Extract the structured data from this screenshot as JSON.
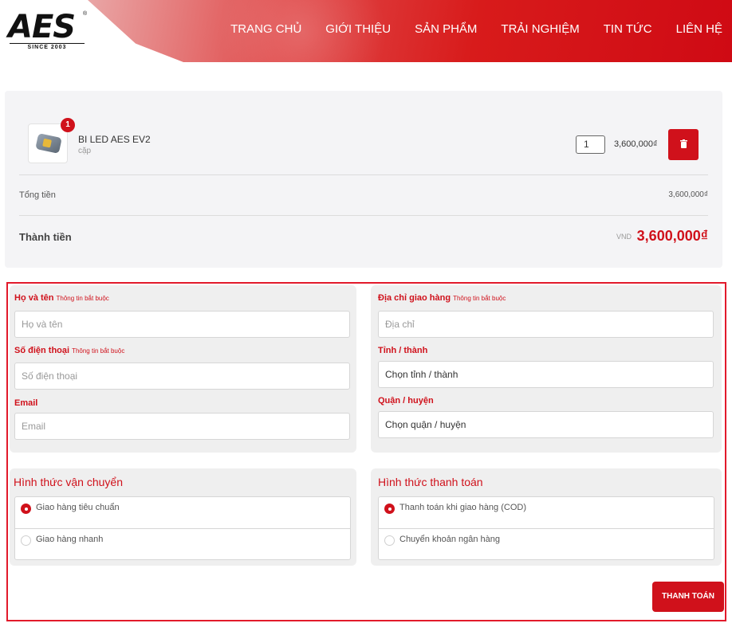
{
  "header": {
    "logo_text": "AES",
    "logo_since": "SINCE 2003",
    "nav": [
      "TRANG CHỦ",
      "GIỚI THIỆU",
      "SẢN PHẨM",
      "TRẢI NGHIỆM",
      "TIN TỨC",
      "LIÊN HỆ"
    ]
  },
  "cart": {
    "item": {
      "badge": "1",
      "name": "BI LED AES EV2",
      "unit": "cặp",
      "quantity": "1",
      "price": "3,600,000₫"
    },
    "subtotal_label": "Tổng tiền",
    "subtotal_value": "3,600,000₫",
    "total_label": "Thành tiền",
    "total_currency": "VND",
    "total_value": "3,600,000₫"
  },
  "form": {
    "required_note": "Thông tin bắt buộc",
    "name": {
      "label": "Họ và tên",
      "placeholder": "Họ và tên"
    },
    "phone": {
      "label": "Số điện thoại",
      "placeholder": "Số điện thoại"
    },
    "email": {
      "label": "Email",
      "placeholder": "Email"
    },
    "address": {
      "label": "Địa chỉ giao hàng",
      "placeholder": "Địa chỉ"
    },
    "province": {
      "label": "Tỉnh / thành",
      "value": "Chọn tỉnh / thành"
    },
    "district": {
      "label": "Quận / huyện",
      "value": "Chọn quận / huyện"
    }
  },
  "shipping": {
    "title": "Hình thức vận chuyển",
    "options": [
      "Giao hàng tiêu chuẩn",
      "Giao hàng nhanh"
    ],
    "selected": 0
  },
  "payment": {
    "title": "Hình thức thanh toán",
    "options": [
      "Thanh toán khi giao hàng (COD)",
      "Chuyển khoản ngân hàng"
    ],
    "selected": 0
  },
  "checkout_button": "THANH TOÁN",
  "colors": {
    "accent": "#d0111b",
    "frame": "#e21a2b"
  }
}
